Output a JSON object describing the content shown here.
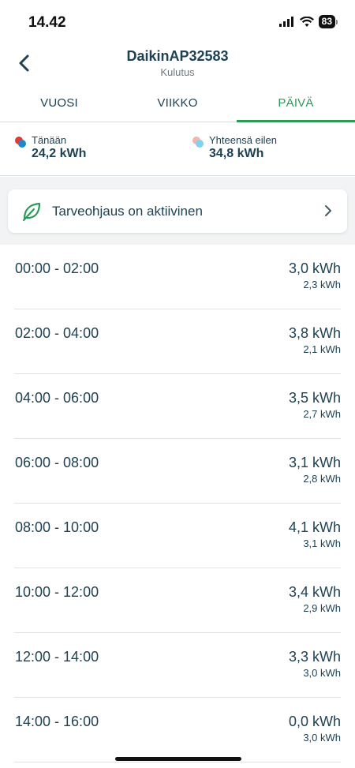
{
  "status_bar": {
    "time": "14.42",
    "battery": "83"
  },
  "header": {
    "title": "DaikinAP32583",
    "subtitle": "Kulutus"
  },
  "tabs": [
    {
      "label": "VUOSI",
      "active": false
    },
    {
      "label": "VIIKKO",
      "active": false
    },
    {
      "label": "PÄIVÄ",
      "active": true
    }
  ],
  "legend": {
    "today": {
      "label": "Tänään",
      "value": "24,2 kWh"
    },
    "yesterday": {
      "label": "Yhteensä eilen",
      "value": "34,8 kWh"
    }
  },
  "demand_control": {
    "label": "Tarveohjaus on aktiivinen"
  },
  "rows": [
    {
      "time": "00:00 - 02:00",
      "value": "3,0 kWh",
      "sub": "2,3 kWh"
    },
    {
      "time": "02:00 - 04:00",
      "value": "3,8 kWh",
      "sub": "2,1 kWh"
    },
    {
      "time": "04:00 - 06:00",
      "value": "3,5 kWh",
      "sub": "2,7 kWh"
    },
    {
      "time": "06:00 - 08:00",
      "value": "3,1 kWh",
      "sub": "2,8 kWh"
    },
    {
      "time": "08:00 - 10:00",
      "value": "4,1 kWh",
      "sub": "3,1 kWh"
    },
    {
      "time": "10:00 - 12:00",
      "value": "3,4 kWh",
      "sub": "2,9 kWh"
    },
    {
      "time": "12:00 - 14:00",
      "value": "3,3 kWh",
      "sub": "3,0 kWh"
    },
    {
      "time": "14:00 - 16:00",
      "value": "0,0 kWh",
      "sub": "3,0 kWh"
    }
  ],
  "colors": {
    "accent_green": "#2f9a57",
    "text_dark": "#1f4152",
    "today_dot_red": "#e53935",
    "today_dot_blue": "#1e88c8",
    "yesterday_dot_pink": "#f4b3b3",
    "yesterday_dot_blue": "#7fd3f0"
  }
}
